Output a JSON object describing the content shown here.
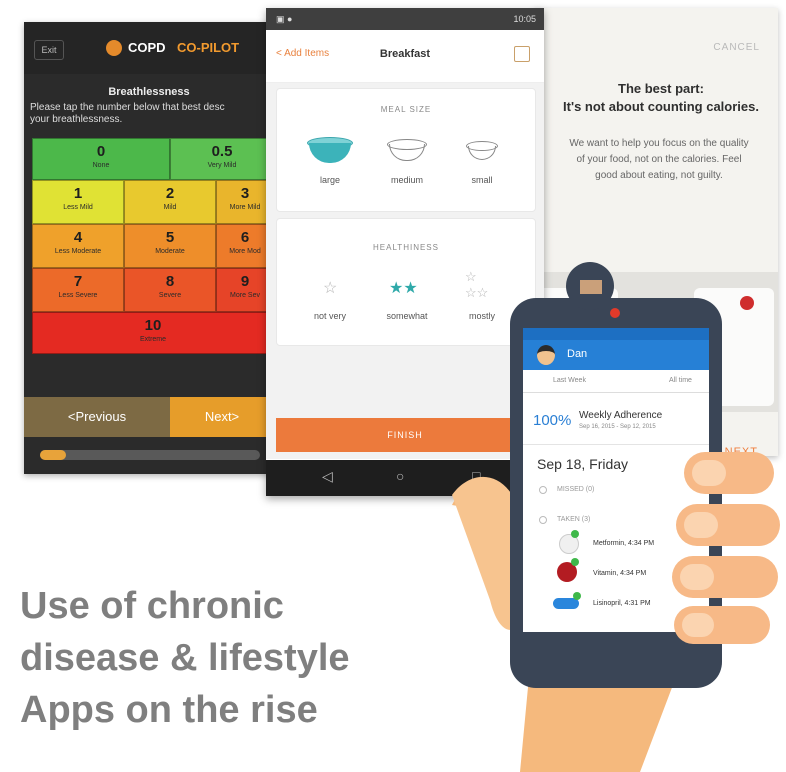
{
  "colors": {
    "accent_orange": "#ec7a3c",
    "copd_orange": "#f29a2e",
    "tracker_blue": "#2680d6",
    "headline_gray": "#7f7f7f"
  },
  "copd_app": {
    "back_label": "Exit",
    "logo_word1": "COPD",
    "logo_word2": "CO-PILOT",
    "heading": "Breathlessness",
    "instruction_line1": "Please tap the number below that best desc",
    "instruction_line2": "your breathlessness.",
    "scale": [
      {
        "value": "0",
        "label": "None"
      },
      {
        "value": "0.5",
        "label": "Very Mild"
      },
      {
        "value": "1",
        "label": "Less Mild"
      },
      {
        "value": "2",
        "label": "Mild"
      },
      {
        "value": "3",
        "label": "More Mild"
      },
      {
        "value": "4",
        "label": "Less Moderate"
      },
      {
        "value": "5",
        "label": "Moderate"
      },
      {
        "value": "6",
        "label": "More Mod"
      },
      {
        "value": "7",
        "label": "Less Severe"
      },
      {
        "value": "8",
        "label": "Severe"
      },
      {
        "value": "9",
        "label": "More Sev"
      },
      {
        "value": "10",
        "label": "Extreme"
      }
    ],
    "previous_label": "<Previous",
    "next_label": "Next>",
    "progress": 0.12
  },
  "meal_app": {
    "status_time": "10:05",
    "back_label": "< Add Items",
    "title": "Breakfast",
    "meal_size_heading": "MEAL SIZE",
    "sizes": [
      "large",
      "medium",
      "small"
    ],
    "healthiness_heading": "HEALTHINESS",
    "health_options": [
      "not very",
      "somewhat",
      "mostly"
    ],
    "finish_label": "FINISH",
    "nav_back_icon": "triangle-back-icon",
    "nav_home_icon": "circle-home-icon",
    "nav_recent_icon": "square-recent-icon"
  },
  "info_app": {
    "cancel_label": "CANCEL",
    "title_line1": "The best part:",
    "title_line2": "It's not about counting calories.",
    "body_line1": "We want to help you focus on the quality",
    "body_line2": "of your food, not on the calories. Feel",
    "body_line3": "good about eating, not guilty.",
    "next_label": "NEXT"
  },
  "tracker_app": {
    "user_name": "Dan",
    "tab_last_week": "Last Week",
    "tab_all_time": "All time",
    "adherence_value": "100%",
    "adherence_title": "Weekly Adherence",
    "adherence_range": "Sep 16, 2015 - Sep 12, 2015",
    "date_heading": "Sep 18, Friday",
    "missed_label": "MISSED (0)",
    "taken_label": "TAKEN (3)",
    "meds": [
      {
        "name": "Metformin, 4:34 PM"
      },
      {
        "name": "Vitamin, 4:34 PM"
      },
      {
        "name": "Lisinopril, 4:31 PM"
      }
    ]
  },
  "headline": {
    "line1": "Use of chronic",
    "line2": "disease & lifestyle",
    "line3": "Apps on the rise"
  }
}
